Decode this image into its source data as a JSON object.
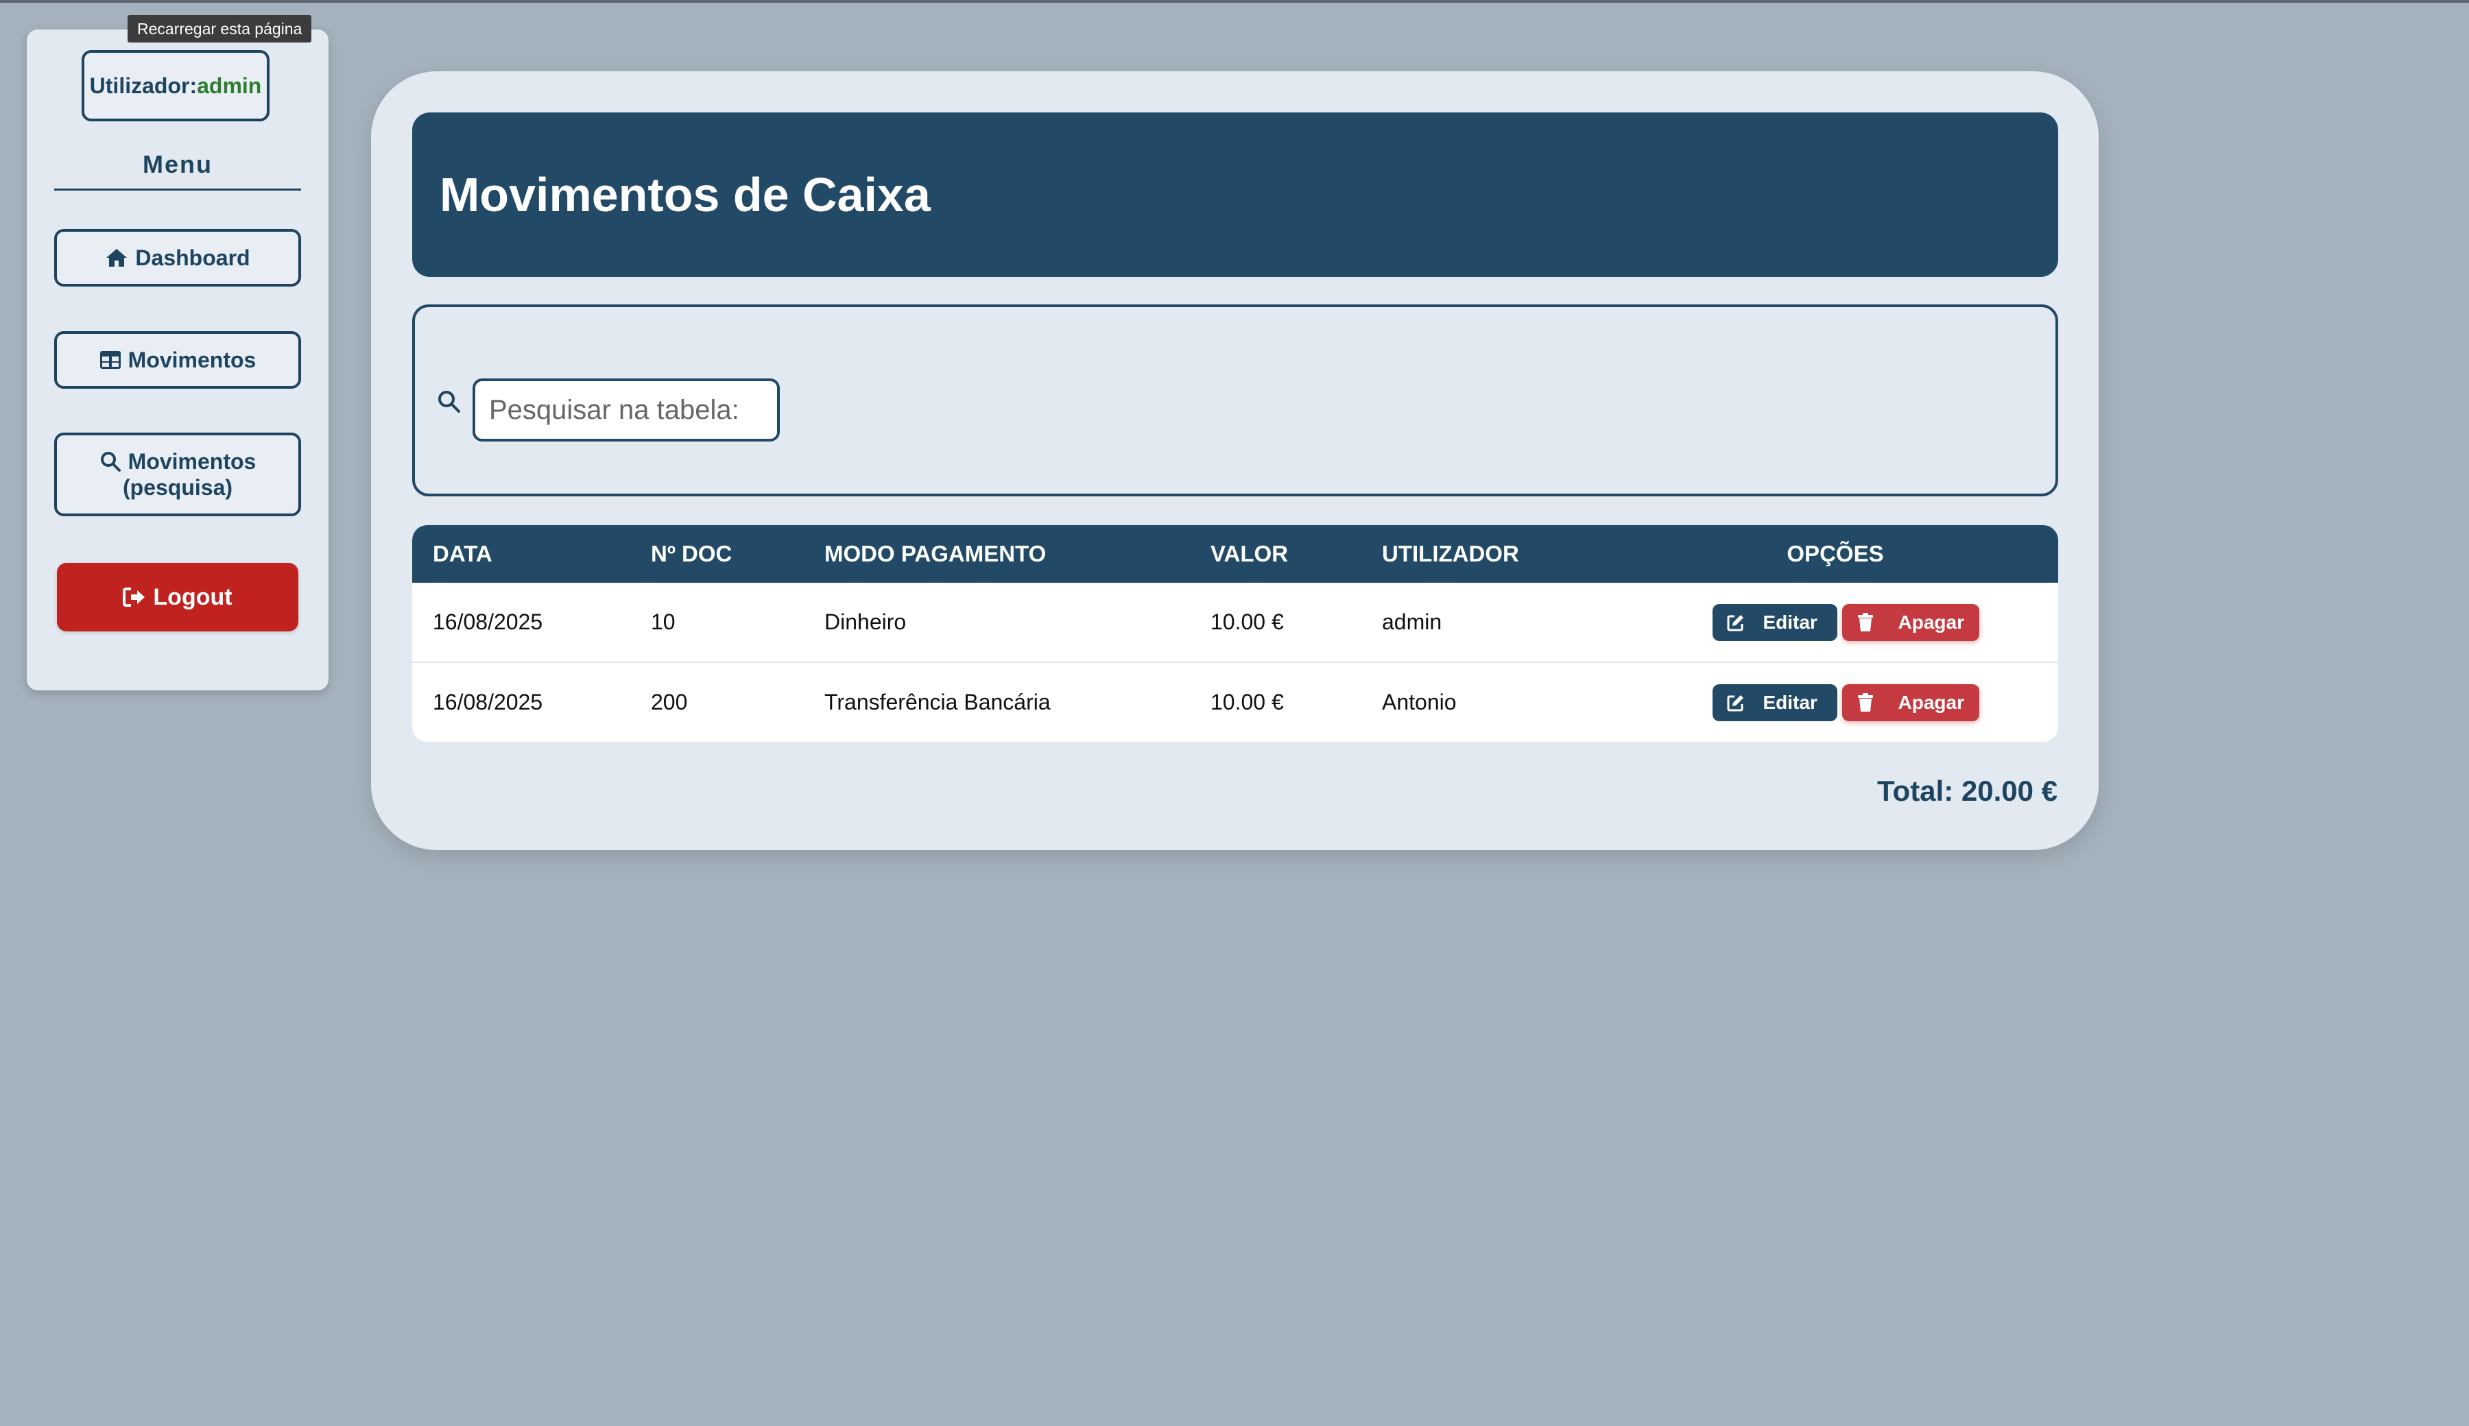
{
  "tooltip": "Recarregar esta página",
  "sidebar": {
    "user_label": "Utilizador:",
    "user_name": "admin",
    "menu_title": "Menu",
    "items": [
      {
        "label": "Dashboard",
        "icon": "home-icon"
      },
      {
        "label": "Movimentos",
        "icon": "table-icon"
      },
      {
        "label_line1": "Movimentos",
        "label_line2": "(pesquisa)",
        "icon": "search-icon"
      }
    ],
    "logout_label": "Logout"
  },
  "main": {
    "title": "Movimentos de Caixa",
    "search": {
      "placeholder": "Pesquisar na tabela:"
    },
    "table": {
      "headers": [
        "DATA",
        "Nº DOC",
        "MODO PAGAMENTO",
        "VALOR",
        "UTILIZADOR",
        "OPÇÕES"
      ],
      "rows": [
        {
          "data": "16/08/2025",
          "doc": "10",
          "modo": "Dinheiro",
          "valor": "10.00 €",
          "utilizador": "admin"
        },
        {
          "data": "16/08/2025",
          "doc": "200",
          "modo": "Transferência Bancária",
          "valor": "10.00 €",
          "utilizador": "Antonio"
        }
      ],
      "edit_label": "Editar",
      "delete_label": "Apagar"
    },
    "total": "Total: 20.00 €"
  },
  "colors": {
    "primary": "#224a66",
    "danger": "#c0221f",
    "delete": "#c53a40",
    "user_green": "#2f7d2f",
    "background": "#a4b2bd",
    "card": "#e2e9f1"
  }
}
